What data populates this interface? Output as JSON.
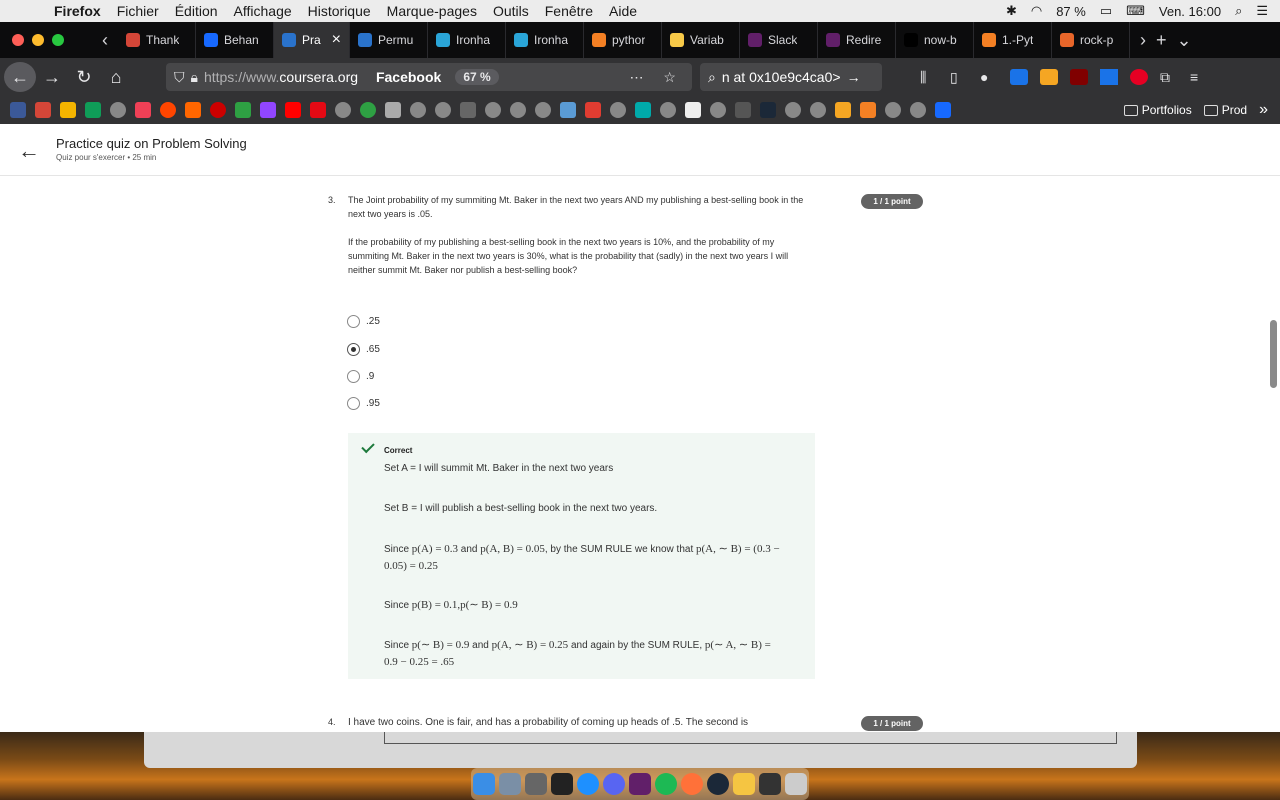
{
  "menubar": {
    "app": "Firefox",
    "items": [
      "Fichier",
      "Édition",
      "Affichage",
      "Historique",
      "Marque-pages",
      "Outils",
      "Fenêtre",
      "Aide"
    ],
    "battery": "87 %",
    "clock": "Ven. 16:00"
  },
  "tabs": [
    {
      "label": "Thank",
      "color": "#d44638"
    },
    {
      "label": "Behan",
      "color": "#1769ff"
    },
    {
      "label": "Pra",
      "color": "#2a73cc",
      "active": true
    },
    {
      "label": "Permu",
      "color": "#2a73cc"
    },
    {
      "label": "Ironha",
      "color": "#2aa5d8"
    },
    {
      "label": "Ironha",
      "color": "#2aa5d8"
    },
    {
      "label": "pythor",
      "color": "#f48024"
    },
    {
      "label": "Variab",
      "color": "#f7c948"
    },
    {
      "label": "Slack",
      "color": "#611f69"
    },
    {
      "label": "Redire",
      "color": "#611f69"
    },
    {
      "label": "now-b",
      "color": "#000000"
    },
    {
      "label": "1.-Pyt",
      "color": "#f48024"
    },
    {
      "label": "rock-p",
      "color": "#e8662a"
    }
  ],
  "nav": {
    "url_prefix": "https://www.",
    "url_domain": "coursera.org",
    "keyword": "Facebook",
    "zoom": "67 %",
    "search_text": "n at 0x10e9c4ca0>"
  },
  "bookmarks": {
    "folders": [
      "Portfolios",
      "Prod"
    ]
  },
  "page": {
    "title": "Practice quiz on Problem Solving",
    "subtitle": "Quiz pour s'exercer • 25  min"
  },
  "question3": {
    "number": "3.",
    "points": "1 / 1 point",
    "text1": "The Joint probability of my summiting Mt. Baker in the next two years AND my publishing a best-selling book in the next two years is .05.",
    "text2": "If the probability of my publishing a best-selling book in the next two years is 10%, and the probability of my summiting Mt. Baker in the next two years is 30%, what is the probability that (sadly) in the next two years I will neither summit Mt. Baker nor publish a best-selling book?",
    "options": [
      ".25",
      ".65",
      ".9",
      ".95"
    ],
    "selected_index": 1
  },
  "feedback": {
    "heading": "Correct",
    "line1": "Set A = I will summit Mt. Baker in the next two years",
    "line2": "Set B = I will publish a best-selling book in the next two years.",
    "line3a": "Since ",
    "line3m1": "p(A) = 0.3",
    "line3b": " and ",
    "line3m2": "p(A, B) = 0.05",
    "line3c": ", by the SUM RULE we know that ",
    "line3m3": "p(A, ∼ B) = (0.3 − 0.05) = 0.25",
    "line4a": "Since ",
    "line4m": "p(B) = 0.1,p(∼ B) = 0.9",
    "line5a": "Since ",
    "line5m1": "p(∼ B) = 0.9",
    "line5b": " and ",
    "line5m2": "p(A, ∼ B) = 0.25",
    "line5c": " and again by the SUM RULE, ",
    "line5m3": "p(∼ A, ∼ B) = 0.9 − 0.25 = .65"
  },
  "question4": {
    "number": "4.",
    "points": "1 / 1 point",
    "text": "I have two coins. One is fair, and has a probability of coming up heads of .5. The second is"
  }
}
